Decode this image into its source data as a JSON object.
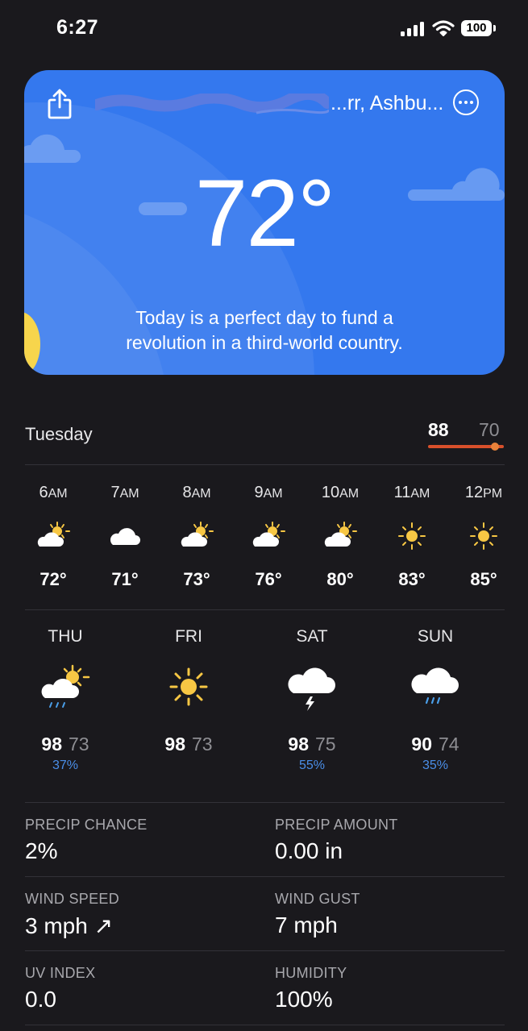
{
  "status_bar": {
    "time": "6:27",
    "battery": "100"
  },
  "header": {
    "location": "...rr, Ashbu...",
    "temperature": "72°",
    "message": [
      "Today is a perfect day to fund a",
      "revolution in a third-world country."
    ]
  },
  "today": {
    "day": "Tuesday",
    "high": "88",
    "low": "70"
  },
  "hourly": [
    {
      "time": "6",
      "period": "AM",
      "icon": "partly-sunny-icon",
      "temp": "72°"
    },
    {
      "time": "7",
      "period": "AM",
      "icon": "cloud-icon",
      "temp": "71°"
    },
    {
      "time": "8",
      "period": "AM",
      "icon": "partly-sunny-icon",
      "temp": "73°"
    },
    {
      "time": "9",
      "period": "AM",
      "icon": "partly-sunny-icon",
      "temp": "76°"
    },
    {
      "time": "10",
      "period": "AM",
      "icon": "partly-sunny-icon",
      "temp": "80°"
    },
    {
      "time": "11",
      "period": "AM",
      "icon": "sun-icon",
      "temp": "83°"
    },
    {
      "time": "12",
      "period": "PM",
      "icon": "sun-icon",
      "temp": "85°"
    }
  ],
  "daily": [
    {
      "day": "THU",
      "icon": "sun-cloud-rain-icon",
      "high": "98",
      "low": "73",
      "precip": "37%"
    },
    {
      "day": "FRI",
      "icon": "sun-icon",
      "high": "98",
      "low": "73",
      "precip": ""
    },
    {
      "day": "SAT",
      "icon": "thunderstorm-icon",
      "high": "98",
      "low": "75",
      "precip": "55%"
    },
    {
      "day": "SUN",
      "icon": "rain-cloud-icon",
      "high": "90",
      "low": "74",
      "precip": "35%"
    }
  ],
  "metrics": {
    "precip_chance": {
      "label": "PRECIP CHANCE",
      "value": "2%"
    },
    "precip_amount": {
      "label": "PRECIP AMOUNT",
      "value": "0.00 in"
    },
    "wind_speed": {
      "label": "WIND SPEED",
      "value": "3 mph ↗"
    },
    "wind_gust": {
      "label": "WIND GUST",
      "value": "7 mph"
    },
    "uv_index": {
      "label": "UV INDEX",
      "value": "0.0"
    },
    "humidity": {
      "label": "HUMIDITY",
      "value": "100%"
    }
  },
  "colors": {
    "card": "#3478ee",
    "background": "#1a191d",
    "range_bar": "#d8502b",
    "precip_text": "#4a8ee8",
    "sun": "#f7d54c"
  }
}
